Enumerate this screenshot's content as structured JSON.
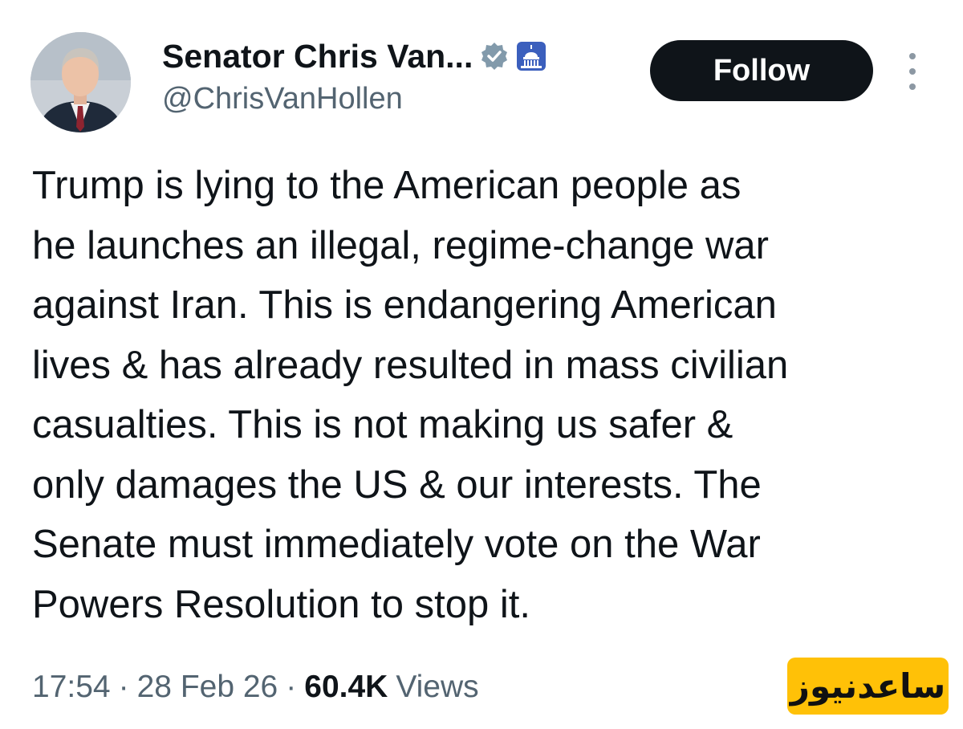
{
  "author": {
    "display_name": "Senator Chris Van...",
    "handle": "@ChrisVanHollen",
    "verified_icon": "verified-badge-icon",
    "affiliation_icon": "capitol-dome-icon",
    "avatar_icon": "profile-photo"
  },
  "actions": {
    "follow_label": "Follow",
    "more_icon": "more-vertical-icon"
  },
  "tweet": {
    "lines": [
      "Trump is lying to the American people as",
      "he launches an illegal, regime-change war",
      "against Iran. This is endangering American",
      "lives & has already resulted in mass civilian",
      "casualties. This is not making us safer &",
      "only damages the US & our interests. The",
      "Senate must immediately vote on the War",
      "Powers Resolution to stop it."
    ]
  },
  "meta": {
    "time": "17:54",
    "separator": "·",
    "date": "28 Feb 26",
    "views_count": "60.4K",
    "views_label": "Views"
  },
  "watermark": {
    "text": "ساعدنیوز"
  },
  "colors": {
    "text": "#0f1419",
    "secondary": "#536471",
    "follow_bg": "#0f1419",
    "watermark_bg": "#ffc107"
  }
}
